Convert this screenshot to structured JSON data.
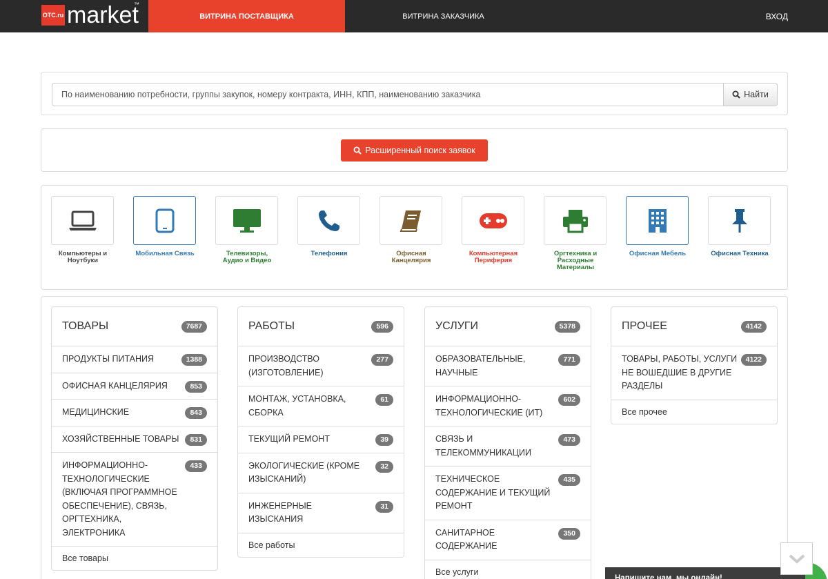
{
  "header": {
    "logo_badge": "OTC.ru",
    "logo_text": "market",
    "logo_tm": "™",
    "nav_supplier": "ВИТРИНА ПОСТАВЩИКА",
    "nav_customer": "ВИТРИНА ЗАКАЗЧИКА",
    "login": "ВХОД"
  },
  "search": {
    "placeholder": "По наименованию потребности, группы закупок, номеру контракта, ИНН, КПП, наименованию заказчика",
    "button_label": "Найти"
  },
  "advanced_search": {
    "button_label": "Расширенный поиск заявок"
  },
  "categories": [
    {
      "label": "Компьютеры и Ноутбуки",
      "icon": "laptop-icon",
      "color": "#444444",
      "border": "#dcdcdc"
    },
    {
      "label": "Мобильная Связь",
      "icon": "tablet-icon",
      "color": "#337ab7",
      "border": "#337ab7"
    },
    {
      "label": "Телевизоры, Аудио и Видео",
      "icon": "monitor-icon",
      "color": "#2e7d32",
      "border": "#dcdcdc"
    },
    {
      "label": "Телефония",
      "icon": "phone-icon",
      "color": "#1f5e8c",
      "border": "#dcdcdc"
    },
    {
      "label": "Офисная Канцелярия",
      "icon": "book-icon",
      "color": "#7a5c2e",
      "border": "#dcdcdc"
    },
    {
      "label": "Компьютерная Периферия",
      "icon": "gamepad-icon",
      "color": "#e53b2c",
      "border": "#dcdcdc"
    },
    {
      "label": "Оргтехника и Расходные Материалы",
      "icon": "printer-icon",
      "color": "#2e7d32",
      "border": "#dcdcdc"
    },
    {
      "label": "Офисная Мебель",
      "icon": "building-icon",
      "color": "#337ab7",
      "border": "#337ab7"
    },
    {
      "label": "Офисная Техника",
      "icon": "pushpin-icon",
      "color": "#1f5e8c",
      "border": "#dcdcdc"
    }
  ],
  "columns": [
    {
      "title": "ТОВАРЫ",
      "count": "7687",
      "items": [
        {
          "label": "ПРОДУКТЫ ПИТАНИЯ",
          "count": "1388"
        },
        {
          "label": "ОФИСНАЯ КАНЦЕЛЯРИЯ",
          "count": "853"
        },
        {
          "label": "МЕДИЦИНСКИЕ",
          "count": "843"
        },
        {
          "label": "ХОЗЯЙСТВЕННЫЕ ТОВАРЫ",
          "count": "831"
        },
        {
          "label": "ИНФОРМАЦИОННО-ТЕХНОЛОГИЧЕСКИЕ (ВКЛЮЧАЯ ПРОГРАММНОЕ ОБЕСПЕЧЕНИЕ), СВЯЗЬ, ОРГТЕХНИКА, ЭЛЕКТРОНИКА",
          "count": "433"
        }
      ],
      "all_label": "Все товары"
    },
    {
      "title": "РАБОТЫ",
      "count": "596",
      "items": [
        {
          "label": "ПРОИЗВОДСТВО (ИЗГОТОВЛЕНИЕ)",
          "count": "277"
        },
        {
          "label": "МОНТАЖ, УСТАНОВКА, СБОРКА",
          "count": "61"
        },
        {
          "label": "ТЕКУЩИЙ РЕМОНТ",
          "count": "39"
        },
        {
          "label": "ЭКОЛОГИЧЕСКИЕ (КРОМЕ ИЗЫСКАНИЙ)",
          "count": "32"
        },
        {
          "label": "ИНЖЕНЕРНЫЕ ИЗЫСКАНИЯ",
          "count": "31"
        }
      ],
      "all_label": "Все работы"
    },
    {
      "title": "УСЛУГИ",
      "count": "5378",
      "items": [
        {
          "label": "ОБРАЗОВАТЕЛЬНЫЕ, НАУЧНЫЕ",
          "count": "771"
        },
        {
          "label": "ИНФОРМАЦИОННО-ТЕХНОЛОГИЧЕСКИЕ (ИТ)",
          "count": "602"
        },
        {
          "label": "СВЯЗЬ И ТЕЛЕКОММУНИКАЦИИ",
          "count": "473"
        },
        {
          "label": "ТЕХНИЧЕСКОЕ СОДЕРЖАНИЕ И ТЕКУЩИЙ РЕМОНТ",
          "count": "435"
        },
        {
          "label": "САНИТАРНОЕ СОДЕРЖАНИЕ",
          "count": "350"
        }
      ],
      "all_label": "Все услуги"
    },
    {
      "title": "ПРОЧЕЕ",
      "count": "4142",
      "items": [
        {
          "label": "ТОВАРЫ, РАБОТЫ, УСЛУГИ НЕ ВОШЕДШИЕ В ДРУГИЕ РАЗДЕЛЫ",
          "count": "4122"
        }
      ],
      "all_label": "Все прочее"
    }
  ],
  "chat": {
    "text": "Напишите нам, мы онлайн!"
  },
  "colors": {
    "accent": "#e8412c",
    "topbar": "#2a2a2a",
    "badge": "#777777",
    "link_blue": "#337ab7",
    "chat_green": "#43b149"
  }
}
